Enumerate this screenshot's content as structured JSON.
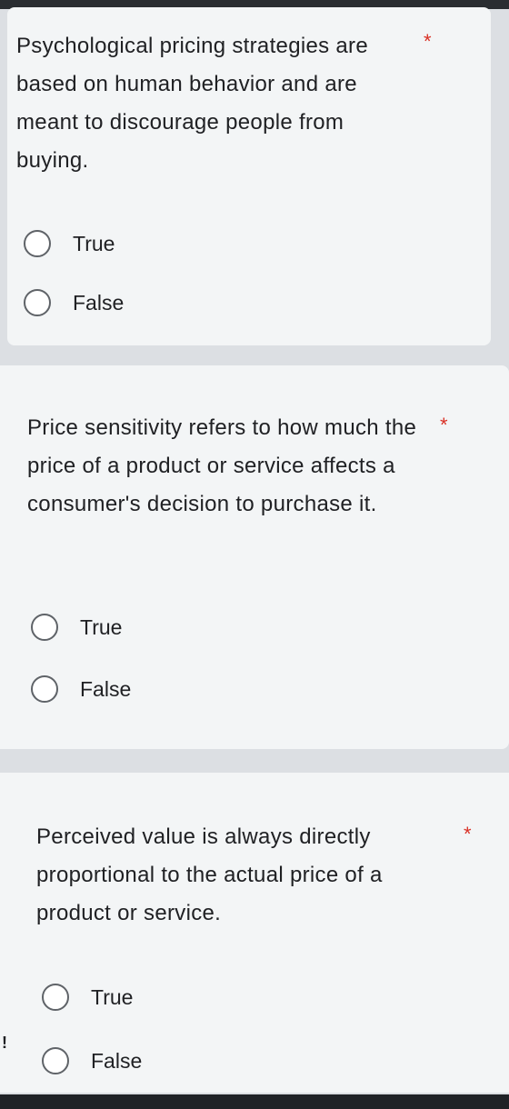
{
  "questions": [
    {
      "text": "Psychological pricing strategies are based on human behavior and are meant to discourage people from buying.",
      "required_mark": "*",
      "options": [
        "True",
        "False"
      ]
    },
    {
      "text": "Price sensitivity refers to how much the price of a product or service affects a consumer's decision to purchase it.",
      "required_mark": "*",
      "options": [
        "True",
        "False"
      ]
    },
    {
      "text": "Perceived value is always directly proportional to the actual price of a product or service.",
      "required_mark": "*",
      "options": [
        "True",
        "False"
      ]
    }
  ],
  "warning_icon": "exclamation-icon",
  "colors": {
    "required": "#d93025",
    "card": "#f3f5f6",
    "background": "#dcdfe3"
  }
}
